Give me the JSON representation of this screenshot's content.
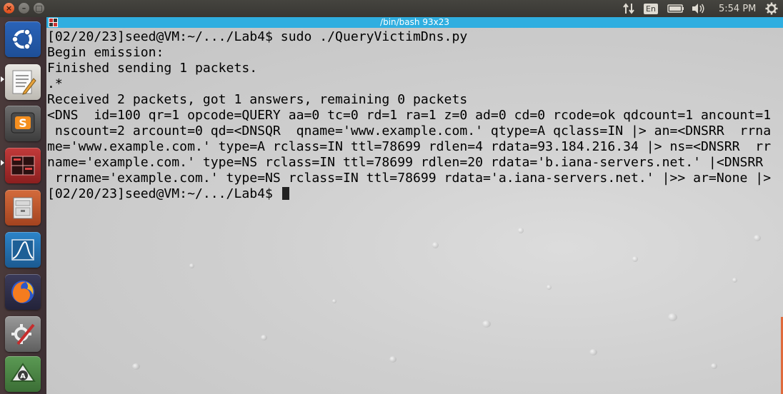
{
  "panel": {
    "clock": "5:54 PM",
    "language": "En",
    "icons": [
      "network-arrows-icon",
      "battery-icon",
      "volume-icon",
      "gear-icon"
    ]
  },
  "window_controls": {
    "close_glyph": "×",
    "minimize_glyph": "–",
    "maximize_glyph": "□"
  },
  "launcher": {
    "items": [
      {
        "name": "ubuntu-dash-icon"
      },
      {
        "name": "text-editor-icon"
      },
      {
        "name": "sublime-text-icon"
      },
      {
        "name": "terminal-icon"
      },
      {
        "name": "file-manager-icon"
      },
      {
        "name": "wireshark-icon"
      },
      {
        "name": "firefox-icon"
      },
      {
        "name": "system-settings-icon"
      },
      {
        "name": "software-updater-icon"
      }
    ]
  },
  "terminal": {
    "title": "/bin/bash 93x23",
    "lines": [
      "[02/20/23]seed@VM:~/.../Lab4$ sudo ./QueryVictimDns.py",
      "Begin emission:",
      "Finished sending 1 packets.",
      ".*",
      "Received 2 packets, got 1 answers, remaining 0 packets",
      "<DNS  id=100 qr=1 opcode=QUERY aa=0 tc=0 rd=1 ra=1 z=0 ad=0 cd=0 rcode=ok qdcount=1 ancount=1",
      " nscount=2 arcount=0 qd=<DNSQR  qname='www.example.com.' qtype=A qclass=IN |> an=<DNSRR  rrna",
      "me='www.example.com.' type=A rclass=IN ttl=78699 rdlen=4 rdata=93.184.216.34 |> ns=<DNSRR  rr",
      "name='example.com.' type=NS rclass=IN ttl=78699 rdlen=20 rdata='b.iana-servers.net.' |<DNSRR ",
      " rrname='example.com.' type=NS rclass=IN ttl=78699 rdata='a.iana-servers.net.' |>> ar=None |>",
      "[02/20/23]seed@VM:~/.../Lab4$ "
    ]
  },
  "colors": {
    "panel_bg": "#3c3b37",
    "titlebar": "#2faee0",
    "close_button": "#e5541f"
  }
}
